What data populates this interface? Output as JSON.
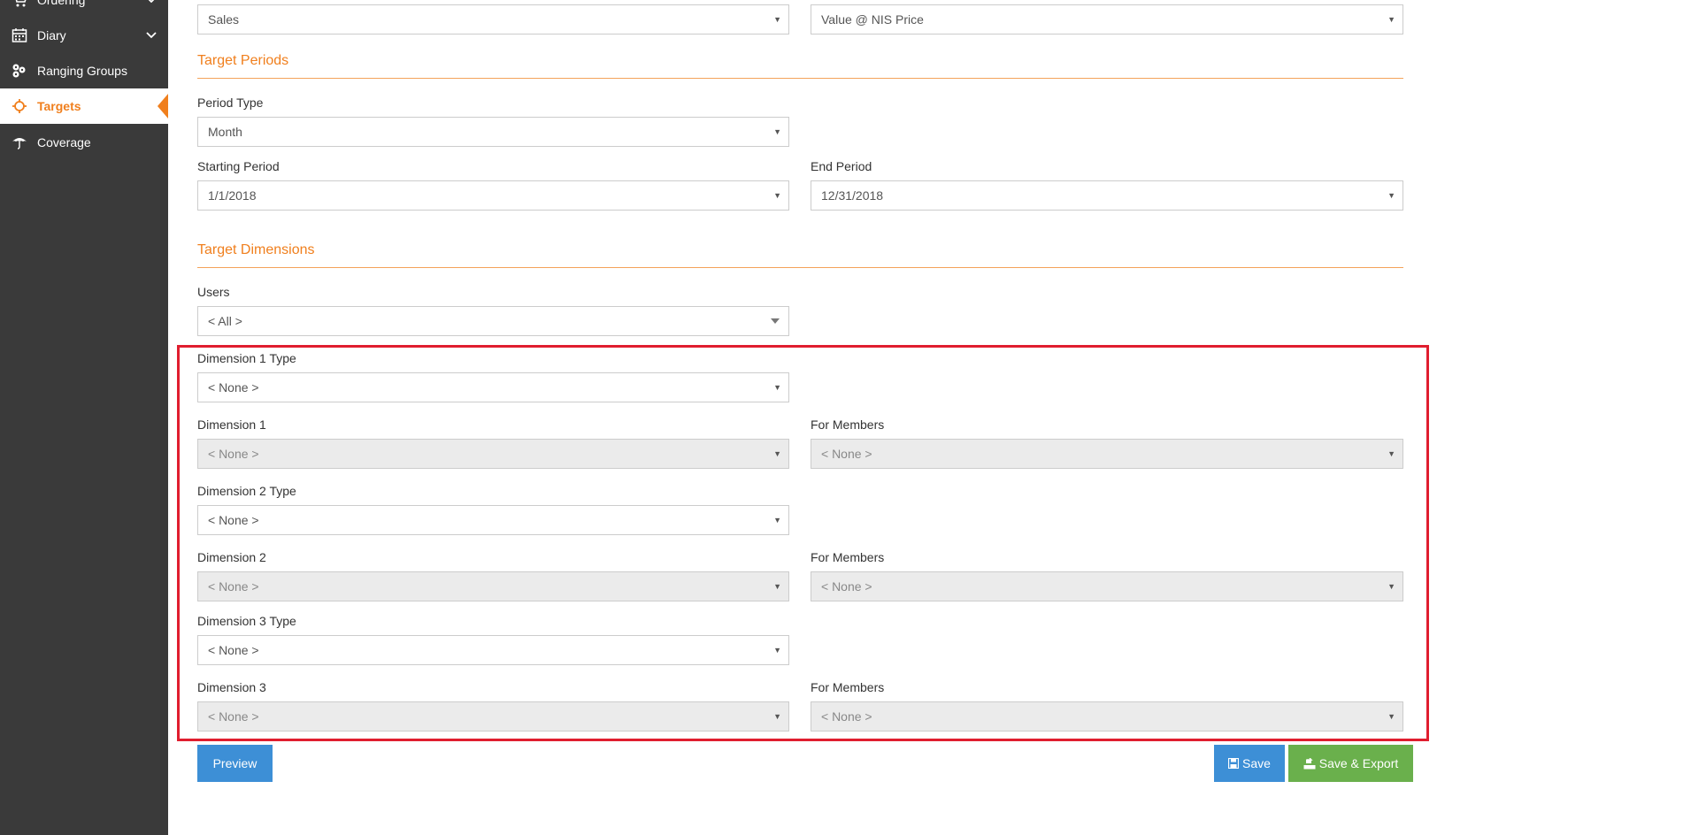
{
  "sidebar": {
    "items": [
      {
        "label": "Ordering",
        "icon": "cart-icon",
        "has_submenu": true
      },
      {
        "label": "Diary",
        "icon": "calendar-icon",
        "has_submenu": true
      },
      {
        "label": "Ranging Groups",
        "icon": "ranging-groups-icon",
        "has_submenu": false
      },
      {
        "label": "Targets",
        "icon": "target-icon",
        "has_submenu": false,
        "active": true
      },
      {
        "label": "Coverage",
        "icon": "umbrella-icon",
        "has_submenu": false
      }
    ]
  },
  "top_selects": {
    "left_value": "Sales",
    "right_value": "Value @ NIS Price"
  },
  "target_periods": {
    "title": "Target Periods",
    "period_type_label": "Period Type",
    "period_type_value": "Month",
    "starting_period_label": "Starting Period",
    "starting_period_value": "1/1/2018",
    "end_period_label": "End Period",
    "end_period_value": "12/31/2018"
  },
  "target_dimensions": {
    "title": "Target Dimensions",
    "users_label": "Users",
    "users_value": "< All >",
    "dim1_type_label": "Dimension 1 Type",
    "dim1_type_value": "< None >",
    "dim1_label": "Dimension 1",
    "dim1_value": "< None >",
    "dim1_members_label": "For Members",
    "dim1_members_value": "< None >",
    "dim2_type_label": "Dimension 2 Type",
    "dim2_type_value": "< None >",
    "dim2_label": "Dimension 2",
    "dim2_value": "< None >",
    "dim2_members_label": "For Members",
    "dim2_members_value": "< None >",
    "dim3_type_label": "Dimension 3 Type",
    "dim3_type_value": "< None >",
    "dim3_label": "Dimension 3",
    "dim3_value": "< None >",
    "dim3_members_label": "For Members",
    "dim3_members_value": "< None >"
  },
  "actions": {
    "preview_label": "Preview",
    "save_label": "Save",
    "save_export_label": "Save & Export"
  },
  "colors": {
    "accent": "#f07f1d",
    "sidebar_bg": "#3a3a3a",
    "highlight": "#e01e2f",
    "button_blue": "#3d8fd6",
    "button_green": "#6ab04c"
  }
}
